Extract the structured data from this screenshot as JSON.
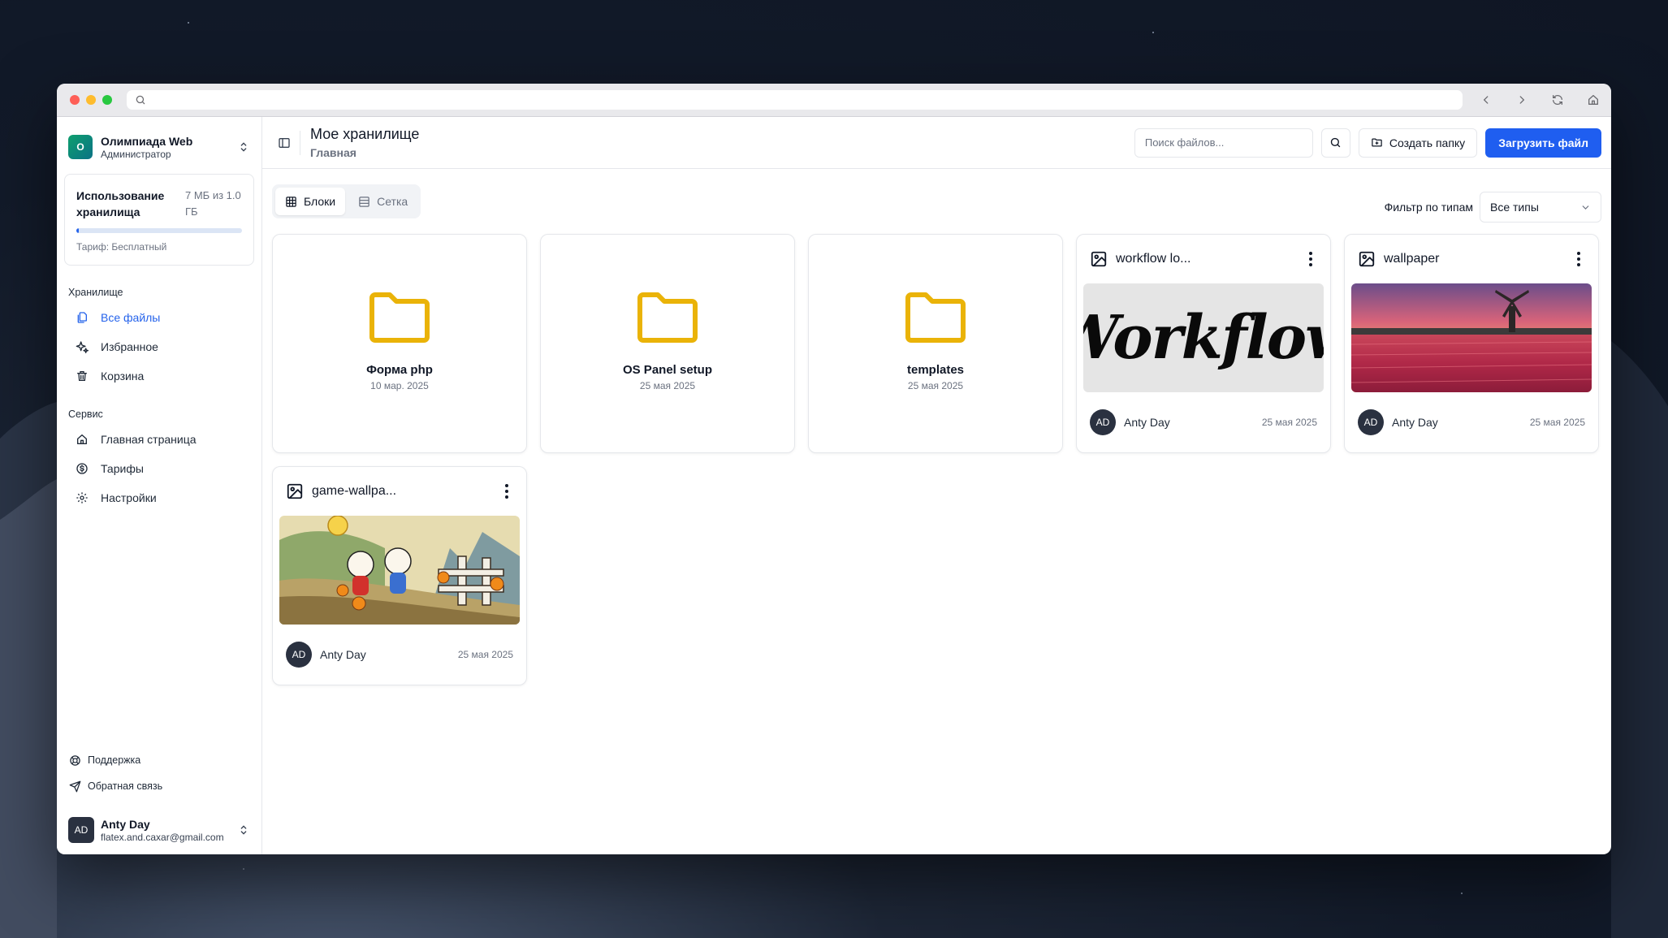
{
  "sidebar": {
    "org": {
      "initial": "O",
      "name": "Олимпиада Web",
      "role": "Администратор"
    },
    "storage": {
      "title": "Использование хранилища",
      "amount": "7 МБ из 1.0 ГБ",
      "used_fraction": 0.007,
      "plan": "Тариф: Бесплатный"
    },
    "sections": [
      {
        "label": "Хранилище",
        "items": [
          {
            "label": "Все файлы",
            "icon": "files-icon",
            "active": true
          },
          {
            "label": "Избранное",
            "icon": "sparkles-icon"
          },
          {
            "label": "Корзина",
            "icon": "trash-icon"
          }
        ]
      },
      {
        "label": "Сервис",
        "items": [
          {
            "label": "Главная страница",
            "icon": "home-icon"
          },
          {
            "label": "Тарифы",
            "icon": "dollar-icon"
          },
          {
            "label": "Настройки",
            "icon": "gear-icon"
          }
        ]
      }
    ],
    "support": "Поддержка",
    "feedback": "Обратная связь",
    "user": {
      "initials": "AD",
      "name": "Anty Day",
      "email": "flatex.and.caxar@gmail.com"
    }
  },
  "header": {
    "title": "Мое хранилище",
    "breadcrumb": "Главная",
    "search_placeholder": "Поиск файлов...",
    "create_folder": "Создать папку",
    "upload": "Загрузить файл"
  },
  "toolbar": {
    "view_blocks": "Блоки",
    "view_grid": "Сетка",
    "filter_label": "Фильтр по типам",
    "filter_value": "Все типы"
  },
  "folders": [
    {
      "name": "Форма php",
      "date": "10 мар. 2025"
    },
    {
      "name": "OS Panel setup",
      "date": "25 мая 2025"
    },
    {
      "name": "templates",
      "date": "25 мая 2025"
    }
  ],
  "files": [
    {
      "name": "workflow lo...",
      "thumb_text": "Workflow",
      "owner_initials": "AD",
      "owner": "Anty Day",
      "date": "25 мая 2025"
    },
    {
      "name": "wallpaper",
      "owner_initials": "AD",
      "owner": "Anty Day",
      "date": "25 мая 2025"
    },
    {
      "name": "game-wallpa...",
      "owner_initials": "AD",
      "owner": "Anty Day",
      "date": "25 мая 2025"
    }
  ],
  "colors": {
    "accent": "#1f5ef0",
    "folder": "#eab308"
  }
}
